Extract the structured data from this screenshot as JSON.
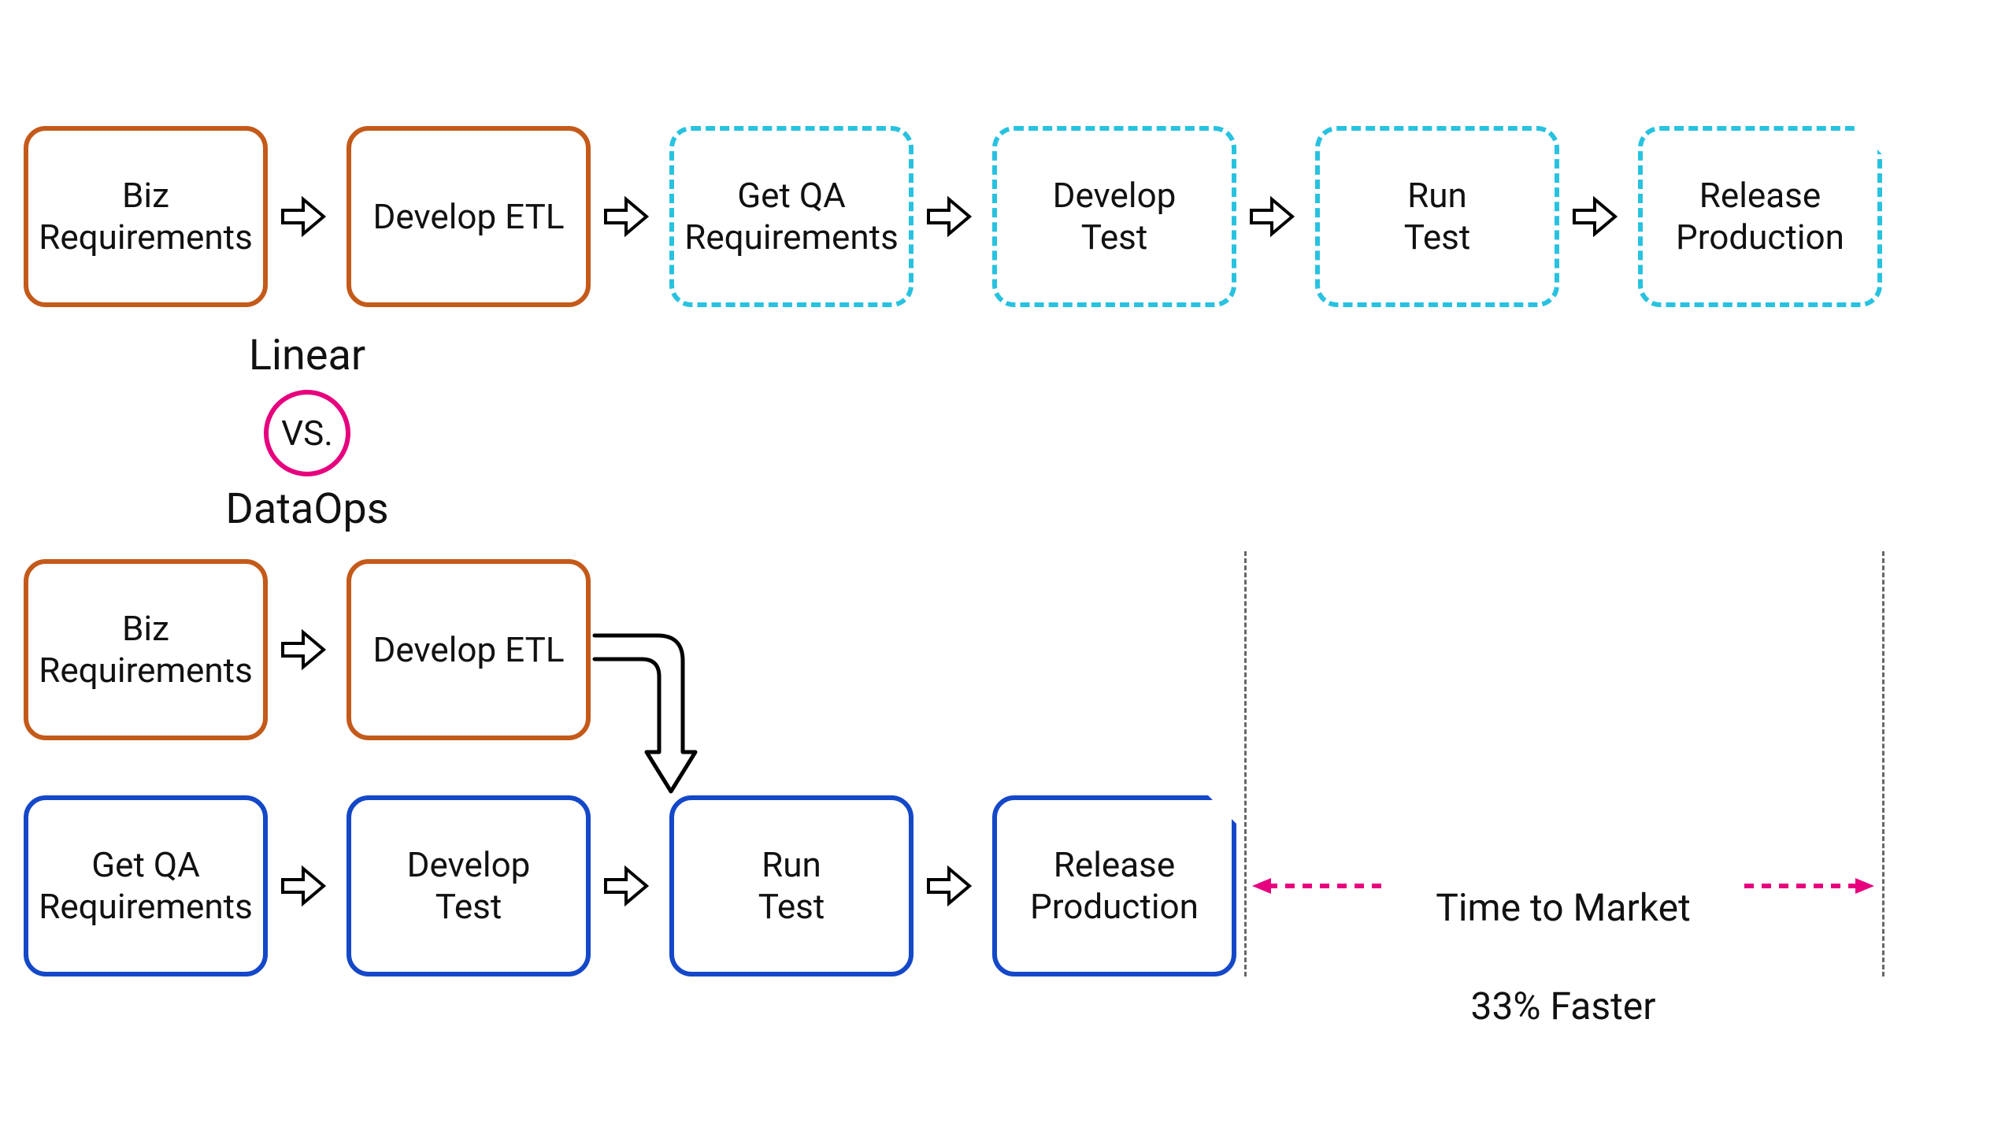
{
  "linear": {
    "label": "Linear",
    "boxes": [
      {
        "id": "biz-req",
        "text": "Biz\nRequirements"
      },
      {
        "id": "develop-etl",
        "text": "Develop ETL"
      },
      {
        "id": "get-qa",
        "text": "Get QA\nRequirements"
      },
      {
        "id": "develop-test",
        "text": "Develop\nTest"
      },
      {
        "id": "run-test",
        "text": "Run\nTest"
      },
      {
        "id": "release",
        "text": "Release\nProduction"
      }
    ]
  },
  "vs_label": "VS.",
  "dataops": {
    "label": "DataOps",
    "top_boxes": [
      {
        "id": "biz-req",
        "text": "Biz\nRequirements"
      },
      {
        "id": "develop-etl",
        "text": "Develop ETL"
      }
    ],
    "bottom_boxes": [
      {
        "id": "get-qa",
        "text": "Get QA\nRequirements"
      },
      {
        "id": "develop-test",
        "text": "Develop\nTest"
      },
      {
        "id": "run-test",
        "text": "Run\nTest"
      },
      {
        "id": "release",
        "text": "Release\nProduction"
      }
    ]
  },
  "time_to_market": {
    "line1": "Time to Market",
    "line2": "33% Faster"
  },
  "colors": {
    "orange": "#c45a1a",
    "cyan": "#28c2e0",
    "blue": "#1448c8",
    "pink": "#e6007e"
  }
}
